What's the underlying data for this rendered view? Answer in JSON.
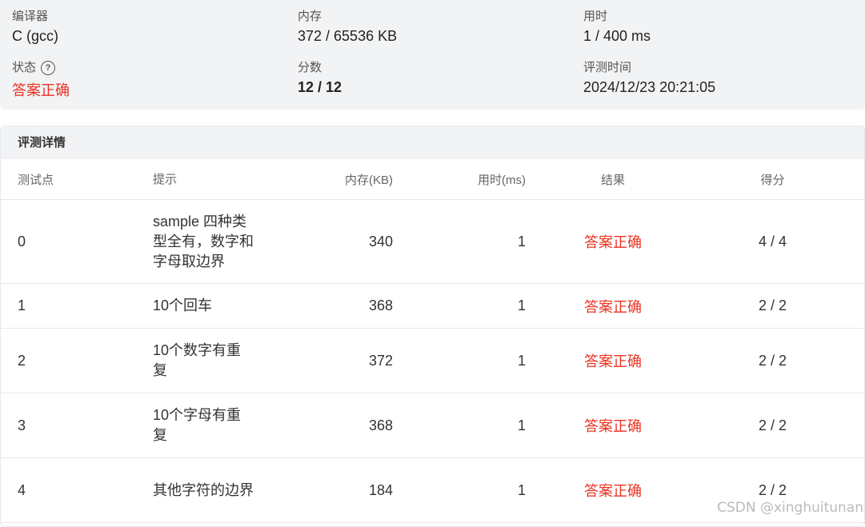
{
  "summary": {
    "compiler_label": "编译器",
    "compiler_value": "C (gcc)",
    "memory_label": "内存",
    "memory_value": "372 / 65536 KB",
    "time_label": "用时",
    "time_value": "1 / 400 ms",
    "status_label": "状态",
    "status_help_icon": "?",
    "status_value": "答案正确",
    "score_label": "分数",
    "score_value": "12 / 12",
    "judge_time_label": "评测时间",
    "judge_time_value": "2024/12/23 20:21:05"
  },
  "colors": {
    "accept": "#ea3323",
    "panel_bg": "#f2f3f5"
  },
  "detail": {
    "title": "评测详情",
    "columns": [
      "测试点",
      "提示",
      "内存(KB)",
      "用时(ms)",
      "结果",
      "得分"
    ],
    "rows": [
      {
        "id": "0",
        "hint": "sample 四种类型全有，数字和字母取边界",
        "memory": "340",
        "time": "1",
        "result": "答案正确",
        "score": "4 / 4"
      },
      {
        "id": "1",
        "hint": "10个回车",
        "memory": "368",
        "time": "1",
        "result": "答案正确",
        "score": "2 / 2"
      },
      {
        "id": "2",
        "hint": "10个数字有重复",
        "memory": "372",
        "time": "1",
        "result": "答案正确",
        "score": "2 / 2"
      },
      {
        "id": "3",
        "hint": "10个字母有重复",
        "memory": "368",
        "time": "1",
        "result": "答案正确",
        "score": "2 / 2"
      },
      {
        "id": "4",
        "hint": "其他字符的边界",
        "memory": "184",
        "time": "1",
        "result": "答案正确",
        "score": "2 / 2"
      }
    ]
  },
  "watermark": "CSDN @xinghuitunan"
}
